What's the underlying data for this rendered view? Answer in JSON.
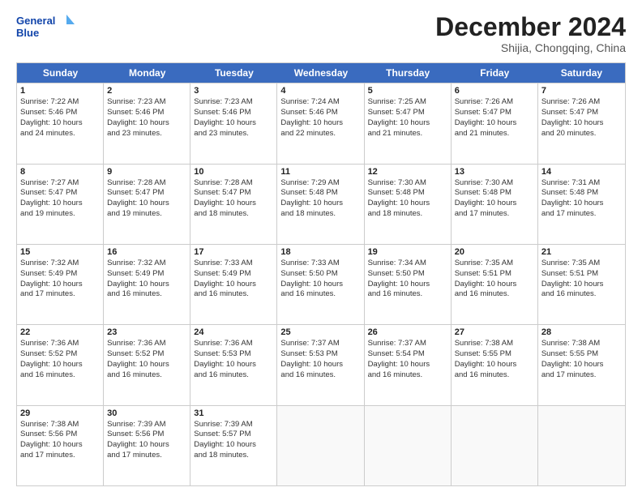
{
  "logo": {
    "line1": "General",
    "line2": "Blue"
  },
  "title": "December 2024",
  "location": "Shijia, Chongqing, China",
  "header_days": [
    "Sunday",
    "Monday",
    "Tuesday",
    "Wednesday",
    "Thursday",
    "Friday",
    "Saturday"
  ],
  "weeks": [
    [
      {
        "day": "1",
        "lines": [
          "Sunrise: 7:22 AM",
          "Sunset: 5:46 PM",
          "Daylight: 10 hours",
          "and 24 minutes."
        ]
      },
      {
        "day": "2",
        "lines": [
          "Sunrise: 7:23 AM",
          "Sunset: 5:46 PM",
          "Daylight: 10 hours",
          "and 23 minutes."
        ]
      },
      {
        "day": "3",
        "lines": [
          "Sunrise: 7:23 AM",
          "Sunset: 5:46 PM",
          "Daylight: 10 hours",
          "and 23 minutes."
        ]
      },
      {
        "day": "4",
        "lines": [
          "Sunrise: 7:24 AM",
          "Sunset: 5:46 PM",
          "Daylight: 10 hours",
          "and 22 minutes."
        ]
      },
      {
        "day": "5",
        "lines": [
          "Sunrise: 7:25 AM",
          "Sunset: 5:47 PM",
          "Daylight: 10 hours",
          "and 21 minutes."
        ]
      },
      {
        "day": "6",
        "lines": [
          "Sunrise: 7:26 AM",
          "Sunset: 5:47 PM",
          "Daylight: 10 hours",
          "and 21 minutes."
        ]
      },
      {
        "day": "7",
        "lines": [
          "Sunrise: 7:26 AM",
          "Sunset: 5:47 PM",
          "Daylight: 10 hours",
          "and 20 minutes."
        ]
      }
    ],
    [
      {
        "day": "8",
        "lines": [
          "Sunrise: 7:27 AM",
          "Sunset: 5:47 PM",
          "Daylight: 10 hours",
          "and 19 minutes."
        ]
      },
      {
        "day": "9",
        "lines": [
          "Sunrise: 7:28 AM",
          "Sunset: 5:47 PM",
          "Daylight: 10 hours",
          "and 19 minutes."
        ]
      },
      {
        "day": "10",
        "lines": [
          "Sunrise: 7:28 AM",
          "Sunset: 5:47 PM",
          "Daylight: 10 hours",
          "and 18 minutes."
        ]
      },
      {
        "day": "11",
        "lines": [
          "Sunrise: 7:29 AM",
          "Sunset: 5:48 PM",
          "Daylight: 10 hours",
          "and 18 minutes."
        ]
      },
      {
        "day": "12",
        "lines": [
          "Sunrise: 7:30 AM",
          "Sunset: 5:48 PM",
          "Daylight: 10 hours",
          "and 18 minutes."
        ]
      },
      {
        "day": "13",
        "lines": [
          "Sunrise: 7:30 AM",
          "Sunset: 5:48 PM",
          "Daylight: 10 hours",
          "and 17 minutes."
        ]
      },
      {
        "day": "14",
        "lines": [
          "Sunrise: 7:31 AM",
          "Sunset: 5:48 PM",
          "Daylight: 10 hours",
          "and 17 minutes."
        ]
      }
    ],
    [
      {
        "day": "15",
        "lines": [
          "Sunrise: 7:32 AM",
          "Sunset: 5:49 PM",
          "Daylight: 10 hours",
          "and 17 minutes."
        ]
      },
      {
        "day": "16",
        "lines": [
          "Sunrise: 7:32 AM",
          "Sunset: 5:49 PM",
          "Daylight: 10 hours",
          "and 16 minutes."
        ]
      },
      {
        "day": "17",
        "lines": [
          "Sunrise: 7:33 AM",
          "Sunset: 5:49 PM",
          "Daylight: 10 hours",
          "and 16 minutes."
        ]
      },
      {
        "day": "18",
        "lines": [
          "Sunrise: 7:33 AM",
          "Sunset: 5:50 PM",
          "Daylight: 10 hours",
          "and 16 minutes."
        ]
      },
      {
        "day": "19",
        "lines": [
          "Sunrise: 7:34 AM",
          "Sunset: 5:50 PM",
          "Daylight: 10 hours",
          "and 16 minutes."
        ]
      },
      {
        "day": "20",
        "lines": [
          "Sunrise: 7:35 AM",
          "Sunset: 5:51 PM",
          "Daylight: 10 hours",
          "and 16 minutes."
        ]
      },
      {
        "day": "21",
        "lines": [
          "Sunrise: 7:35 AM",
          "Sunset: 5:51 PM",
          "Daylight: 10 hours",
          "and 16 minutes."
        ]
      }
    ],
    [
      {
        "day": "22",
        "lines": [
          "Sunrise: 7:36 AM",
          "Sunset: 5:52 PM",
          "Daylight: 10 hours",
          "and 16 minutes."
        ]
      },
      {
        "day": "23",
        "lines": [
          "Sunrise: 7:36 AM",
          "Sunset: 5:52 PM",
          "Daylight: 10 hours",
          "and 16 minutes."
        ]
      },
      {
        "day": "24",
        "lines": [
          "Sunrise: 7:36 AM",
          "Sunset: 5:53 PM",
          "Daylight: 10 hours",
          "and 16 minutes."
        ]
      },
      {
        "day": "25",
        "lines": [
          "Sunrise: 7:37 AM",
          "Sunset: 5:53 PM",
          "Daylight: 10 hours",
          "and 16 minutes."
        ]
      },
      {
        "day": "26",
        "lines": [
          "Sunrise: 7:37 AM",
          "Sunset: 5:54 PM",
          "Daylight: 10 hours",
          "and 16 minutes."
        ]
      },
      {
        "day": "27",
        "lines": [
          "Sunrise: 7:38 AM",
          "Sunset: 5:55 PM",
          "Daylight: 10 hours",
          "and 16 minutes."
        ]
      },
      {
        "day": "28",
        "lines": [
          "Sunrise: 7:38 AM",
          "Sunset: 5:55 PM",
          "Daylight: 10 hours",
          "and 17 minutes."
        ]
      }
    ],
    [
      {
        "day": "29",
        "lines": [
          "Sunrise: 7:38 AM",
          "Sunset: 5:56 PM",
          "Daylight: 10 hours",
          "and 17 minutes."
        ]
      },
      {
        "day": "30",
        "lines": [
          "Sunrise: 7:39 AM",
          "Sunset: 5:56 PM",
          "Daylight: 10 hours",
          "and 17 minutes."
        ]
      },
      {
        "day": "31",
        "lines": [
          "Sunrise: 7:39 AM",
          "Sunset: 5:57 PM",
          "Daylight: 10 hours",
          "and 18 minutes."
        ]
      },
      null,
      null,
      null,
      null
    ]
  ]
}
